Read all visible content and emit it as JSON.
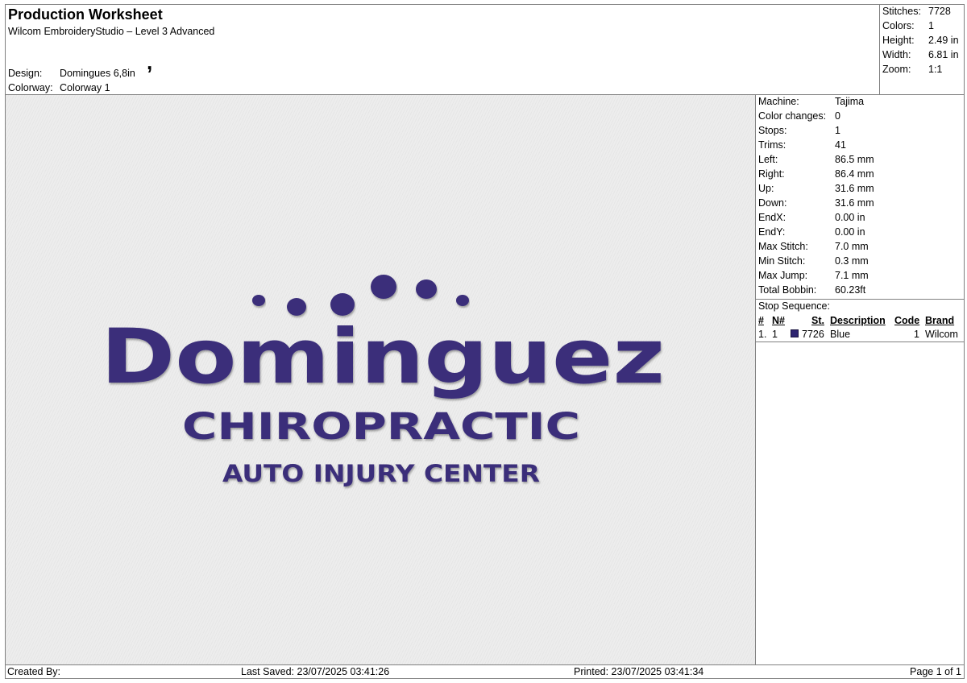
{
  "header": {
    "title": "Production Worksheet",
    "software": "Wilcom EmbroideryStudio – Level 3 Advanced",
    "mark": ",",
    "design_label": "Design:",
    "design_value": "Domingues 6,8in",
    "colorway_label": "Colorway:",
    "colorway_value": "Colorway 1"
  },
  "summary": [
    {
      "label": "Stitches:",
      "value": "7728"
    },
    {
      "label": "Colors:",
      "value": "1"
    },
    {
      "label": "Height:",
      "value": "2.49 in"
    },
    {
      "label": "Width:",
      "value": "6.81 in"
    },
    {
      "label": "Zoom:",
      "value": "1:1"
    }
  ],
  "details": [
    {
      "label": "Machine:",
      "value": "Tajima"
    },
    {
      "label": "Color changes:",
      "value": "0"
    },
    {
      "label": "Stops:",
      "value": "1"
    },
    {
      "label": "Trims:",
      "value": "41"
    },
    {
      "label": "Left:",
      "value": "86.5 mm"
    },
    {
      "label": "Right:",
      "value": "86.4 mm"
    },
    {
      "label": "Up:",
      "value": "31.6 mm"
    },
    {
      "label": "Down:",
      "value": "31.6 mm"
    },
    {
      "label": "EndX:",
      "value": "0.00 in"
    },
    {
      "label": "EndY:",
      "value": "0.00 in"
    },
    {
      "label": "Max Stitch:",
      "value": "7.0 mm"
    },
    {
      "label": "Min Stitch:",
      "value": "0.3 mm"
    },
    {
      "label": "Max Jump:",
      "value": "7.1 mm"
    },
    {
      "label": "Total Bobbin:",
      "value": "60.23ft"
    }
  ],
  "stop_sequence": {
    "title": "Stop Sequence:",
    "headers": {
      "num": "#",
      "needle": "N#",
      "stitches": "St.",
      "description": "Description",
      "code": "Code",
      "brand": "Brand"
    },
    "rows": [
      {
        "num": "1.",
        "needle": "1",
        "stitches": "7726",
        "description": "Blue",
        "code": "1",
        "brand": "Wilcom",
        "color": "#2d2470"
      }
    ]
  },
  "design_preview": {
    "line1": "Dominguez",
    "line2": "CHIROPRACTIC",
    "line3": "AUTO INJURY CENTER",
    "thread_color": "#3a2f7a"
  },
  "footer": {
    "created": "Created By:",
    "saved": "Last Saved: 23/07/2025 03:41:26",
    "printed": "Printed: 23/07/2025 03:41:34",
    "page": "Page 1 of 1"
  }
}
